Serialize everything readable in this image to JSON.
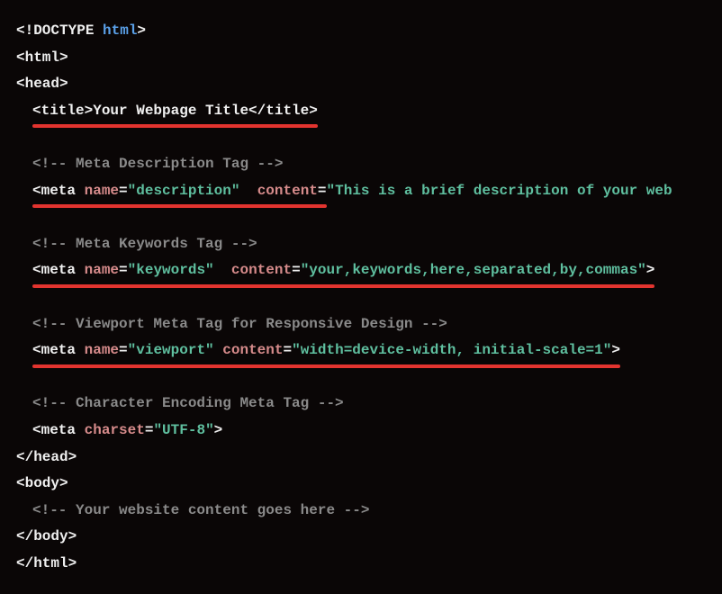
{
  "lines": {
    "l1_open": "<!DOCTYPE ",
    "l1_kw": "html",
    "l1_close": ">",
    "l2": "<html>",
    "l3": "<head>",
    "title_open": "<title>",
    "title_text": "Your Webpage Title",
    "title_close": "</title>",
    "c1": "<!-- Meta Description Tag -->",
    "meta_open": "<meta",
    "sp": " ",
    "name_attr": "name",
    "eq": "=",
    "content_attr": "content",
    "desc_name_val": "\"description\"",
    "desc_content_val": "\"This is a brief description of your web",
    "c2": "<!-- Meta Keywords Tag -->",
    "kw_name_val": "\"keywords\"",
    "kw_content_val": "\"your,keywords,here,separated,by,commas\"",
    "kw_close": ">",
    "c3": "<!-- Viewport Meta Tag for Responsive Design -->",
    "vp_name_val": "\"viewport\"",
    "vp_content_val": "\"width=device-width, initial-scale=1\"",
    "vp_close": ">",
    "c4": "<!-- Character Encoding Meta Tag -->",
    "charset_attr": "charset",
    "charset_val": "\"UTF-8\"",
    "charset_close": ">",
    "head_close": "</head>",
    "body_open": "<body>",
    "c5": "<!-- Your website content goes here -->",
    "body_close": "</body>",
    "html_close": "</html>"
  }
}
